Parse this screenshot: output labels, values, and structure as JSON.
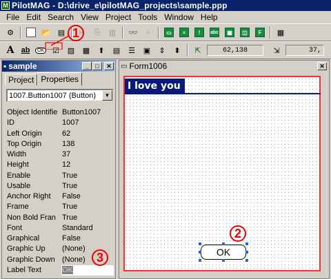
{
  "app": {
    "title": "PilotMAG - D:\\drive_e\\pilotMAG_projects\\sample.ppp",
    "icon_letter": "M"
  },
  "menu": [
    "File",
    "Edit",
    "Search",
    "View",
    "Project",
    "Tools",
    "Window",
    "Help"
  ],
  "toolbar": {
    "coords": "62,138",
    "size": "37,"
  },
  "callouts": [
    "1",
    "2",
    "3"
  ],
  "project_panel": {
    "title": "sample",
    "tabs": [
      "Project",
      "Properties"
    ],
    "selected_object": "1007.Button1007 (Button)",
    "properties": [
      {
        "name": "Object Identifie",
        "value": "Button1007"
      },
      {
        "name": "ID",
        "value": "1007"
      },
      {
        "name": "Left Origin",
        "value": "62"
      },
      {
        "name": "Top Origin",
        "value": "138"
      },
      {
        "name": "Width",
        "value": "37"
      },
      {
        "name": "Height",
        "value": "12"
      },
      {
        "name": "Enable",
        "value": "True"
      },
      {
        "name": "Usable",
        "value": "True"
      },
      {
        "name": "Anchor Right",
        "value": "False"
      },
      {
        "name": "Frame",
        "value": "True"
      },
      {
        "name": "Non Bold Fran",
        "value": "True"
      },
      {
        "name": "Font",
        "value": "Standard"
      },
      {
        "name": "Graphical",
        "value": "False"
      },
      {
        "name": "Graphic Up",
        "value": "(None)"
      },
      {
        "name": "Graphic Down",
        "value": "(None)"
      },
      {
        "name": "Label Text",
        "value": "OK"
      }
    ]
  },
  "form_window": {
    "title": "Form1006",
    "form_title": "I love you",
    "button_label": "OK"
  }
}
